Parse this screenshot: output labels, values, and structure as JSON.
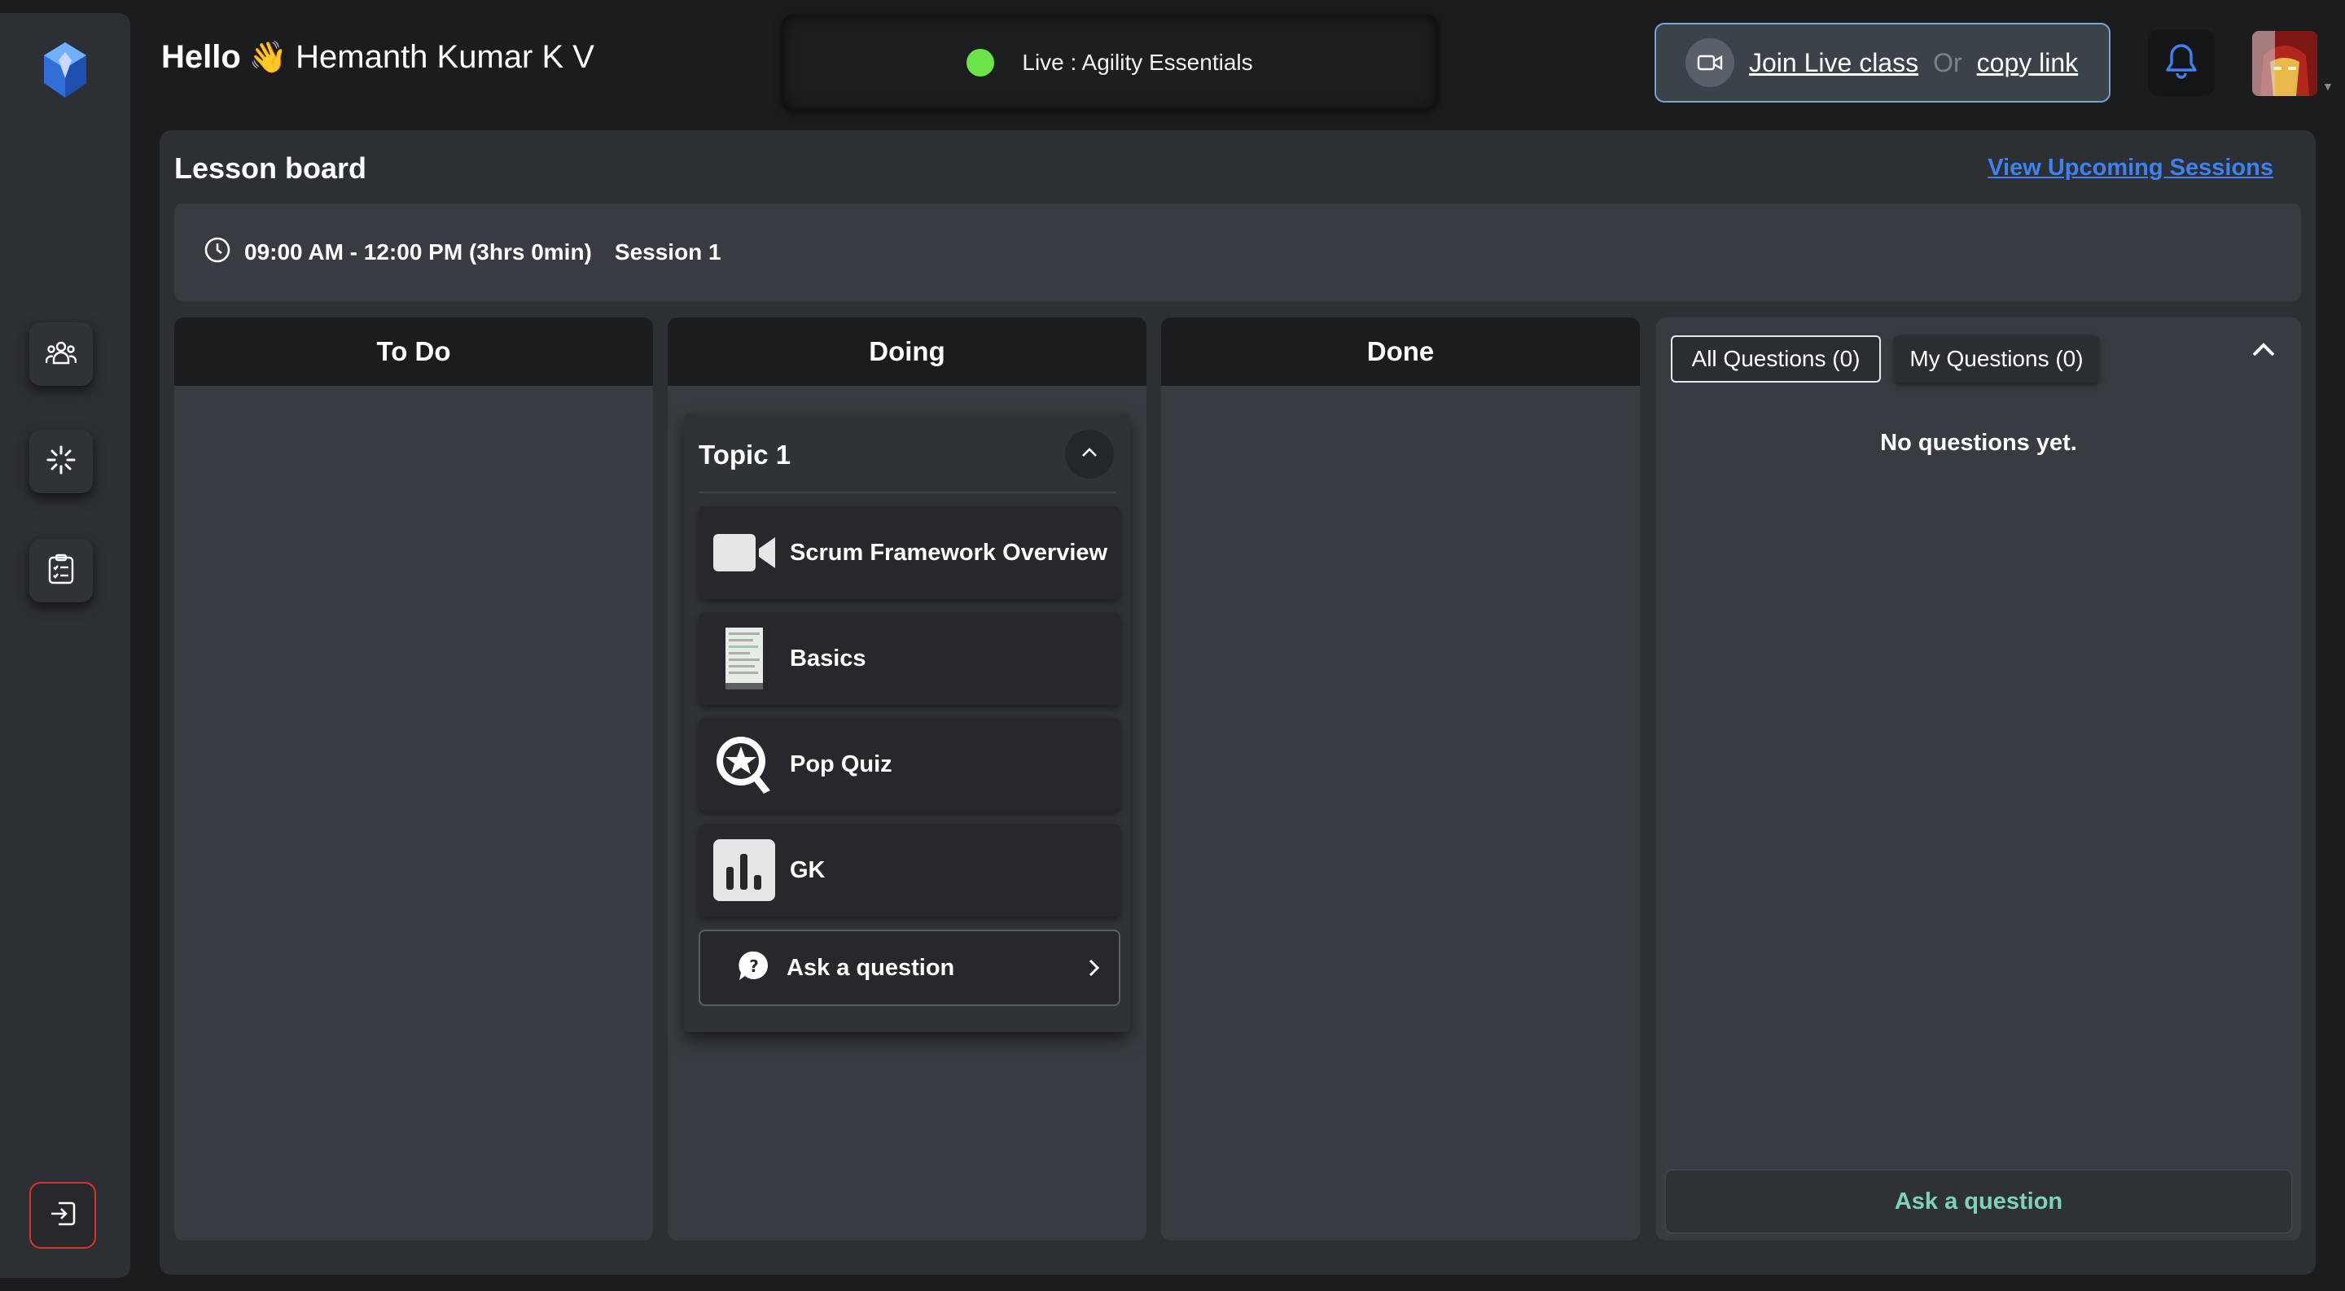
{
  "header": {
    "hello": "Hello",
    "wave_icon": "waving-hand-icon",
    "user_name": "Hemanth Kumar K V",
    "live_label": "Live : Agility Essentials",
    "live_status_color": "#6de34a",
    "join_label": "Join Live class",
    "or_label": "Or",
    "copy_label": "copy link"
  },
  "sidebar": {
    "items": [
      {
        "icon": "users-icon"
      },
      {
        "icon": "sparkle-icon"
      },
      {
        "icon": "checklist-icon"
      }
    ],
    "logout_icon": "logout-icon"
  },
  "lesson": {
    "title": "Lesson board",
    "upcoming_link": "View Upcoming Sessions",
    "time_range": "09:00 AM - 12:00 PM (3hrs 0min)",
    "session_label": "Session 1"
  },
  "columns": {
    "todo": "To Do",
    "doing": "Doing",
    "done": "Done"
  },
  "topic": {
    "title": "Topic 1",
    "items": [
      {
        "label": "Scrum Framework Overview",
        "icon": "video-camera-icon"
      },
      {
        "label": "Basics",
        "icon": "document-thumbnail-icon"
      },
      {
        "label": "Pop Quiz",
        "icon": "quiz-star-icon"
      },
      {
        "label": "GK",
        "icon": "bar-chart-icon"
      }
    ],
    "ask_label": "Ask a question"
  },
  "questions": {
    "all_tab": "All Questions (0)",
    "my_tab": "My Questions (0)",
    "empty_text": "No questions yet.",
    "ask_button": "Ask a question"
  },
  "colors": {
    "accent_link": "#3d82f0",
    "ask_green": "#7ed3b6",
    "logout_red": "#d9342b",
    "bell_blue": "#3d82f0"
  }
}
